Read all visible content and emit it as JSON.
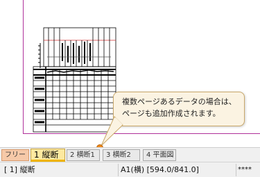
{
  "tabs": {
    "free_label": "フリー",
    "items": [
      {
        "label": "1 縦断"
      },
      {
        "label": "2 横断1"
      },
      {
        "label": "3 横断2"
      },
      {
        "label": "4 平面図"
      }
    ]
  },
  "status": {
    "layer": "[ 1] 縦断",
    "paper": "A1(横) [594.0/841.0]",
    "mask": "****"
  },
  "callout": {
    "line1": "複数ページあるデータの場合は、",
    "line2": "ページも追加作成されます。"
  },
  "colors": {
    "page_border": "#b0309a",
    "active_tab": "#fde9a0",
    "free_tab": "#f6c9a8",
    "callout_bg": "#fbf3e2",
    "marker": "#f08a1c"
  }
}
